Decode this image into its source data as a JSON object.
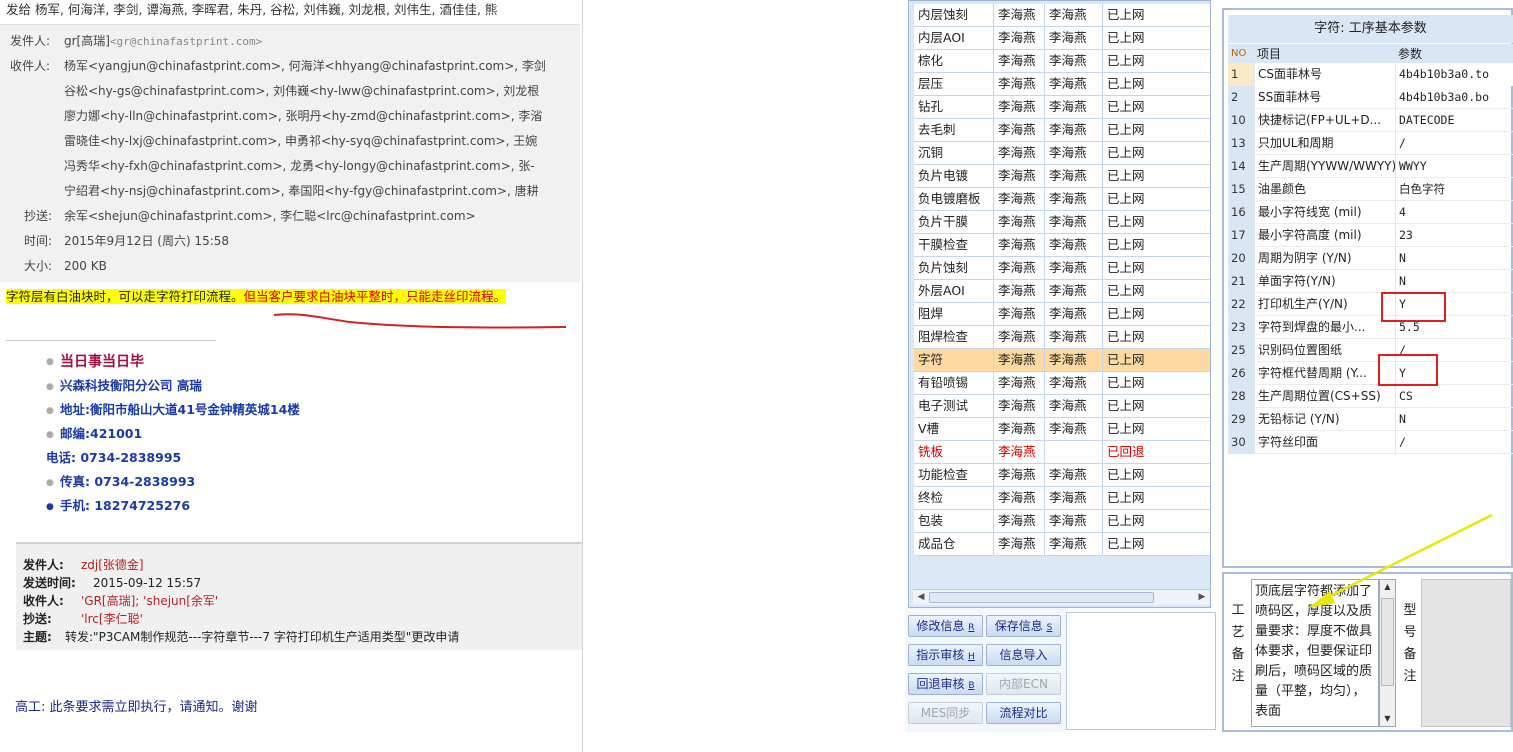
{
  "email": {
    "sendto": "发给 杨军, 何海洋, 李剑, 谭海燕, 李晖君, 朱丹, 谷松, 刘伟巍, 刘龙根, 刘伟生, 酒佳佳, 熊",
    "from_label": "发件人:",
    "from_value": "gr[高瑞]",
    "from_addr": "<gr@chinafastprint.com>",
    "to_label": "收件人:",
    "to_lines": [
      "杨军<yangjun@chinafastprint.com>,   何海洋<hhyang@chinafastprint.com>,   李剑",
      "谷松<hy-gs@chinafastprint.com>,   刘伟巍<hy-lww@chinafastprint.com>,   刘龙根",
      "廖力娜<hy-lln@chinafastprint.com>,   张明丹<hy-zmd@chinafastprint.com>,   李渻",
      "雷晓佳<hy-lxj@chinafastprint.com>,   申勇祁<hy-syq@chinafastprint.com>,   王婉",
      "冯秀华<hy-fxh@chinafastprint.com>,   龙勇<hy-longy@chinafastprint.com>,   张-",
      "宁绍君<hy-nsj@chinafastprint.com>,   奉国阳<hy-fgy@chinafastprint.com>,   唐耕"
    ],
    "cc_label": "抄送:",
    "cc_value": "余军<shejun@chinafastprint.com>,   李仁聪<lrc@chinafastprint.com>",
    "time_label": "时间:",
    "time_value": "2015年9月12日 (周六) 15:58",
    "size_label": "大小:",
    "size_value": "200 KB",
    "note_part1": "字符层有白油块时，可以走字符打印流程。",
    "note_part2": "但当客户要求白油块平整时，只能走丝印流程。",
    "signature": [
      "当日事当日毕",
      "兴森科技衡阳分公司    高瑞",
      "地址:衡阳市船山大道41号金钟精英城14楼",
      "邮编:421001",
      "电话: 0734-2838995",
      "传真: 0734-2838993",
      "手机: 18274725276"
    ],
    "forward": {
      "from_label": "发件人:",
      "from_value": "zdj[张德金]",
      "date_label": "发送时间:",
      "date_value": "2015-09-12 15:57",
      "to_label": "收件人:",
      "to_value": "'GR[高瑞]; 'shejun[余军'",
      "cc_label": "抄送:",
      "cc_value": "'lrc[李仁聪'",
      "subject_label": "主题:",
      "subject_value": "转发:\"P3CAM制作规范---字符章节---7 字符打印机生产适用类型\"更改申请"
    },
    "closing": "高工:  此条要求需立即执行，请通知。谢谢"
  },
  "processes": [
    {
      "name": "内层蚀刻",
      "a": "李海燕",
      "b": "李海燕",
      "status": "已上网"
    },
    {
      "name": "内层AOI",
      "a": "李海燕",
      "b": "李海燕",
      "status": "已上网"
    },
    {
      "name": "棕化",
      "a": "李海燕",
      "b": "李海燕",
      "status": "已上网"
    },
    {
      "name": "层压",
      "a": "李海燕",
      "b": "李海燕",
      "status": "已上网"
    },
    {
      "name": "钻孔",
      "a": "李海燕",
      "b": "李海燕",
      "status": "已上网"
    },
    {
      "name": "去毛刺",
      "a": "李海燕",
      "b": "李海燕",
      "status": "已上网"
    },
    {
      "name": "沉铜",
      "a": "李海燕",
      "b": "李海燕",
      "status": "已上网"
    },
    {
      "name": "负片电镀",
      "a": "李海燕",
      "b": "李海燕",
      "status": "已上网"
    },
    {
      "name": "负电镀磨板",
      "a": "李海燕",
      "b": "李海燕",
      "status": "已上网"
    },
    {
      "name": "负片干膜",
      "a": "李海燕",
      "b": "李海燕",
      "status": "已上网"
    },
    {
      "name": "干膜检查",
      "a": "李海燕",
      "b": "李海燕",
      "status": "已上网"
    },
    {
      "name": "负片蚀刻",
      "a": "李海燕",
      "b": "李海燕",
      "status": "已上网"
    },
    {
      "name": "外层AOI",
      "a": "李海燕",
      "b": "李海燕",
      "status": "已上网"
    },
    {
      "name": "阻焊",
      "a": "李海燕",
      "b": "李海燕",
      "status": "已上网"
    },
    {
      "name": "阻焊检查",
      "a": "李海燕",
      "b": "李海燕",
      "status": "已上网"
    },
    {
      "name": "字符",
      "a": "李海燕",
      "b": "李海燕",
      "status": "已上网",
      "selected": true
    },
    {
      "name": "有铅喷锡",
      "a": "李海燕",
      "b": "李海燕",
      "status": "已上网"
    },
    {
      "name": "电子测试",
      "a": "李海燕",
      "b": "李海燕",
      "status": "已上网"
    },
    {
      "name": "V槽",
      "a": "李海燕",
      "b": "李海燕",
      "status": "已上网"
    },
    {
      "name": "铣板",
      "a": "李海燕",
      "b": "",
      "status": "已回退",
      "returned": true
    },
    {
      "name": "功能检查",
      "a": "李海燕",
      "b": "李海燕",
      "status": "已上网"
    },
    {
      "name": "终检",
      "a": "李海燕",
      "b": "李海燕",
      "status": "已上网"
    },
    {
      "name": "包装",
      "a": "李海燕",
      "b": "李海燕",
      "status": "已上网"
    },
    {
      "name": "成品仓",
      "a": "李海燕",
      "b": "李海燕",
      "status": "已上网"
    }
  ],
  "buttons": {
    "modify": "修改信息",
    "modify_key": "R",
    "save": "保存信息",
    "save_key": "S",
    "instruct": "指示审核",
    "instruct_key": "H",
    "import": "信息导入",
    "rollback": "回退审核",
    "rollback_key": "B",
    "ecn": "内部ECN",
    "mes": "MES同步",
    "compare": "流程对比"
  },
  "params": {
    "title": "字符: 工序基本参数",
    "col_no": "NO",
    "col_item": "项目",
    "col_value": "参数",
    "rows": [
      {
        "no": "1",
        "item": "CS面菲林号",
        "value": "4b4b10b3a0.to"
      },
      {
        "no": "2",
        "item": "SS面菲林号",
        "value": "4b4b10b3a0.bo"
      },
      {
        "no": "10",
        "item": "快捷标记(FP+UL+D...",
        "value": "DATECODE"
      },
      {
        "no": "13",
        "item": "只加UL和周期",
        "value": "/"
      },
      {
        "no": "14",
        "item": "生产周期(YYWW/WWYY)",
        "value": "WWYY"
      },
      {
        "no": "15",
        "item": "油墨颜色",
        "value": "白色字符"
      },
      {
        "no": "16",
        "item": "最小字符线宽 (mil)",
        "value": "4"
      },
      {
        "no": "17",
        "item": "最小字符高度 (mil)",
        "value": "23"
      },
      {
        "no": "20",
        "item": "周期为阴字 (Y/N)",
        "value": "N"
      },
      {
        "no": "21",
        "item": "单面字符(Y/N)",
        "value": "N"
      },
      {
        "no": "22",
        "item": "打印机生产(Y/N)",
        "value": "Y"
      },
      {
        "no": "23",
        "item": "字符到焊盘的最小...",
        "value": "5.5"
      },
      {
        "no": "25",
        "item": "识别码位置图纸",
        "value": "/"
      },
      {
        "no": "26",
        "item": "字符框代替周期 (Y...",
        "value": "Y"
      },
      {
        "no": "28",
        "item": "生产周期位置(CS+SS)",
        "value": "CS"
      },
      {
        "no": "29",
        "item": "无铅标记 (Y/N)",
        "value": "N"
      },
      {
        "no": "30",
        "item": "字符丝印面",
        "value": "/"
      }
    ]
  },
  "notes": {
    "process_label": "工艺备注",
    "process_text": "顶底层字符都添加了喷码区，厚度以及质量要求：厚度不做具体要求，但要保证印刷后，喷码区域的质量（平整，均匀），表面",
    "model_label": "型号备注"
  },
  "colors": {
    "highlight_yellow": "#ffff00",
    "note_red": "#d00000",
    "annotation_red": "#e01e1e",
    "annotation_arrow": "#e8e800",
    "selected_row": "#fcd9a0",
    "signature_blue": "#1a3aa4"
  },
  "icons": [
    "scroll-left-arrow",
    "scroll-right-arrow",
    "scroll-up-arrow",
    "scroll-down-arrow"
  ]
}
